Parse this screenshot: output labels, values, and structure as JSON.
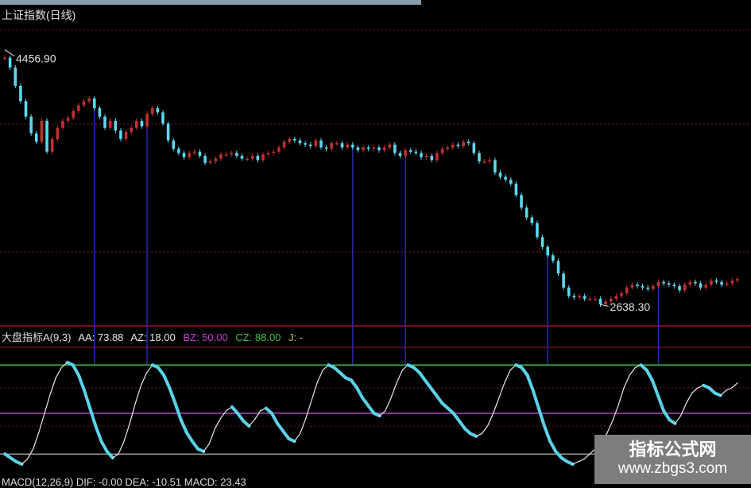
{
  "title": "上证指数(日线)",
  "colors": {
    "up": "#c03030",
    "down": "#5ed8ee",
    "osc_up": "#e8e8e8",
    "osc_down": "#5ad2e8",
    "hi_line": "#40c040",
    "mid_line": "#b040c0",
    "low_line": "#e8e8e8",
    "marker": "#2a2aa8",
    "grid": "#7a1020"
  },
  "oscillator": {
    "name_label": "大盘指标A(9,3)",
    "aa_label": "AA: 73.88",
    "az_label": "AZ: 18.00",
    "bz_label": "BZ: 50.00",
    "cz_label": "CZ: 88.00",
    "j_label": "J: -"
  },
  "macd_label_partial": "MACD(12,26,9)  DIF: -0.00  DEA: -10.51  MACD: 23.43",
  "watermark": {
    "line1": "指标公式网",
    "line2": "www.zbgs3.com"
  },
  "chart_data": [
    {
      "type": "candlestick",
      "title": "上证指数(日线)",
      "annotations": [
        {
          "text": "4456.90",
          "kind": "high"
        },
        {
          "text": "2638.30",
          "kind": "low"
        }
      ],
      "ylim": [
        2600,
        4500
      ],
      "closes": [
        4400,
        4330,
        4200,
        4090,
        3980,
        3860,
        3800,
        3950,
        3730,
        3820,
        3900,
        3950,
        3970,
        4020,
        4060,
        4090,
        4110,
        4040,
        3980,
        3900,
        3950,
        3880,
        3820,
        3870,
        3900,
        3950,
        3910,
        4000,
        4040,
        4010,
        3930,
        3810,
        3750,
        3720,
        3690,
        3720,
        3730,
        3700,
        3650,
        3660,
        3680,
        3710,
        3710,
        3720,
        3700,
        3680,
        3680,
        3700,
        3670,
        3710,
        3720,
        3730,
        3760,
        3800,
        3820,
        3810,
        3790,
        3780,
        3770,
        3810,
        3760,
        3750,
        3790,
        3790,
        3760,
        3780,
        3760,
        3740,
        3760,
        3750,
        3760,
        3740,
        3760,
        3780,
        3720,
        3700,
        3740,
        3730,
        3720,
        3690,
        3700,
        3670,
        3720,
        3750,
        3760,
        3780,
        3770,
        3800,
        3790,
        3720,
        3660,
        3660,
        3670,
        3580,
        3550,
        3530,
        3500,
        3420,
        3330,
        3260,
        3220,
        3120,
        3050,
        2990,
        2950,
        2860,
        2760,
        2700,
        2690,
        2700,
        2680,
        2680,
        2680,
        2640,
        2660,
        2680,
        2700,
        2720,
        2760,
        2780,
        2770,
        2760,
        2750,
        2770,
        2800,
        2790,
        2780,
        2770,
        2740,
        2780,
        2800,
        2790,
        2760,
        2780,
        2810,
        2800,
        2780,
        2790,
        2810,
        2820
      ],
      "marked_indices": [
        17,
        27,
        66,
        76,
        103,
        124
      ],
      "note": "Each candle's up/down colour follows close vs previous close."
    },
    {
      "type": "line",
      "title": "大盘指标A(9,3)",
      "series": [
        {
          "name": "AA",
          "values": [
            18,
            15,
            12,
            10,
            14,
            22,
            35,
            50,
            65,
            78,
            86,
            90,
            88,
            80,
            68,
            54,
            40,
            28,
            20,
            15,
            18,
            28,
            42,
            58,
            72,
            82,
            88,
            86,
            80,
            70,
            58,
            45,
            35,
            28,
            22,
            20,
            26,
            38,
            46,
            52,
            55,
            50,
            44,
            40,
            45,
            52,
            54,
            50,
            42,
            36,
            30,
            28,
            34,
            46,
            60,
            74,
            84,
            88,
            86,
            82,
            78,
            76,
            70,
            62,
            56,
            50,
            48,
            52,
            62,
            74,
            84,
            88,
            86,
            82,
            76,
            70,
            64,
            58,
            54,
            50,
            44,
            38,
            34,
            32,
            34,
            40,
            50,
            62,
            74,
            84,
            88,
            86,
            80,
            68,
            54,
            40,
            28,
            20,
            15,
            12,
            10,
            12,
            14,
            18,
            22,
            28,
            34,
            44,
            56,
            70,
            80,
            86,
            88,
            84,
            76,
            64,
            52,
            45,
            42,
            48,
            58,
            66,
            70,
            72,
            70,
            66,
            64,
            68,
            70,
            73.88
          ]
        }
      ],
      "hlines": [
        {
          "label": "CZ",
          "value": 88
        },
        {
          "label": "BZ",
          "value": 50
        },
        {
          "label": "AZ",
          "value": 18
        }
      ],
      "ylim": [
        0,
        100
      ]
    }
  ]
}
